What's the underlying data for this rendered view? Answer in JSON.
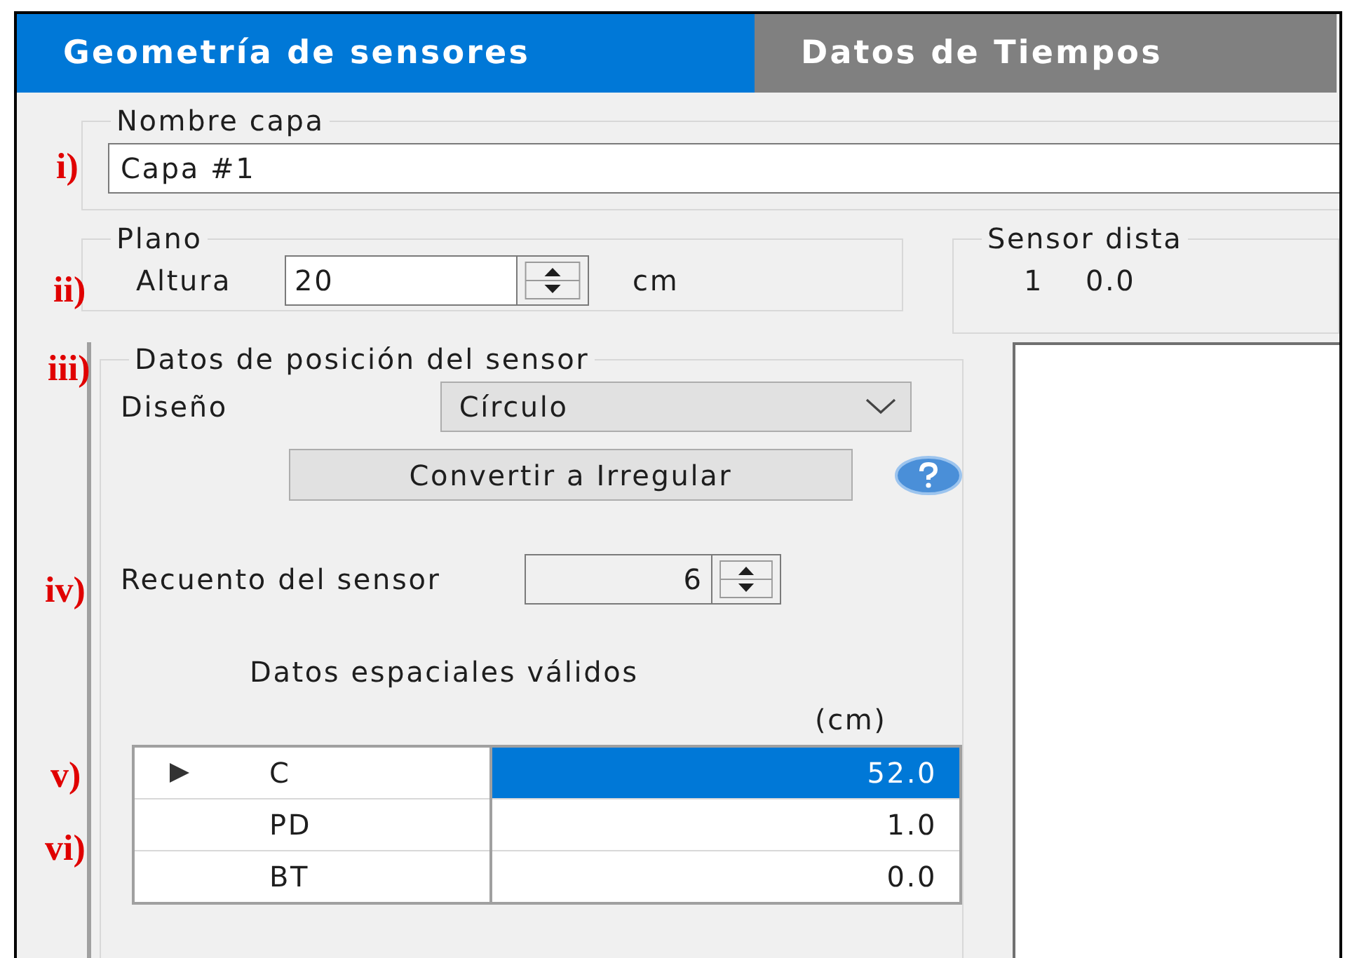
{
  "tabs": [
    {
      "label": "Geometría de sensores",
      "selected": true
    },
    {
      "label": "Datos de Tiempos",
      "selected": false
    }
  ],
  "layer_name": {
    "legend": "Nombre capa",
    "value": "Capa #1"
  },
  "plane": {
    "legend": "Plano",
    "label": "Altura",
    "value": "20",
    "unit": "cm"
  },
  "sensor_distance": {
    "legend": "Sensor dista",
    "index": "1",
    "value": "0.0"
  },
  "position": {
    "legend": "Datos de posición del sensor",
    "design_label": "Diseño",
    "design_value": "Círculo",
    "convert_button": "Convertir a Irregular",
    "count_label": "Recuento del sensor",
    "count_value": "6",
    "table_title": "Datos espaciales válidos",
    "unit": "(cm)",
    "rows": [
      {
        "name": "C",
        "value": "52.0",
        "selected": true
      },
      {
        "name": "PD",
        "value": "1.0",
        "selected": false
      },
      {
        "name": "BT",
        "value": "0.0",
        "selected": false
      }
    ]
  },
  "annotations": [
    "i)",
    "ii)",
    "iii)",
    "iv)",
    "v)",
    "vi)"
  ]
}
